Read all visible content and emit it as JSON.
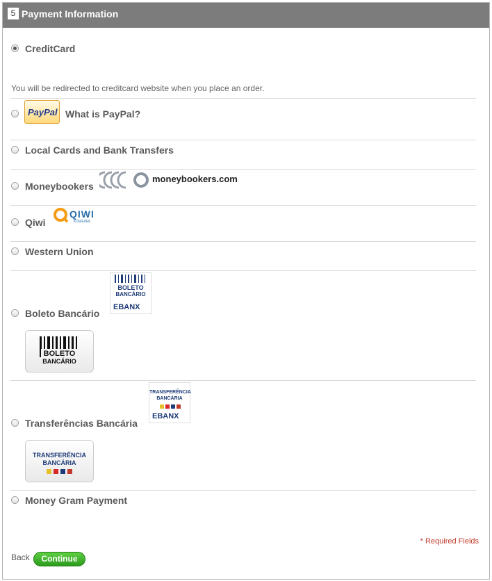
{
  "header": {
    "step_number": "5",
    "title": "Payment Information"
  },
  "payment_methods": [
    {
      "label": "CreditCard",
      "selected": true,
      "note": "You will be redirected to creditcard website when you place an order."
    },
    {
      "label": "What is PayPal?",
      "logo_text": "PayPal",
      "selected": false
    },
    {
      "label": "Local Cards and Bank Transfers",
      "selected": false
    },
    {
      "label": "Moneybookers",
      "logo_text": "moneybookers.com",
      "selected": false
    },
    {
      "label": "Qiwi",
      "logo_text": "QIWI",
      "logo_sub": "КОШЕЛЕК",
      "selected": false
    },
    {
      "label": "Western Union",
      "selected": false
    },
    {
      "label": "Boleto Bancário",
      "logo_text_1": "BOLETO",
      "logo_text_2": "BANCÁRIO",
      "logo_ebanx": "EBANX",
      "selected": false
    },
    {
      "label": "Transferências Bancária",
      "logo_text_1": "TRANSFERÊNCIA",
      "logo_text_2": "BANCÁRIA",
      "logo_ebanx": "EBANX",
      "selected": false
    },
    {
      "label": "Money Gram Payment",
      "selected": false
    }
  ],
  "footer": {
    "required_note": "* Required Fields",
    "back_label": "Back",
    "continue_label": "Continue"
  },
  "colors": {
    "header_bg": "#7c7c7c",
    "continue_green": "#2c9b1d",
    "required_red": "#c0392b",
    "brand_navy": "#1f3c78"
  }
}
